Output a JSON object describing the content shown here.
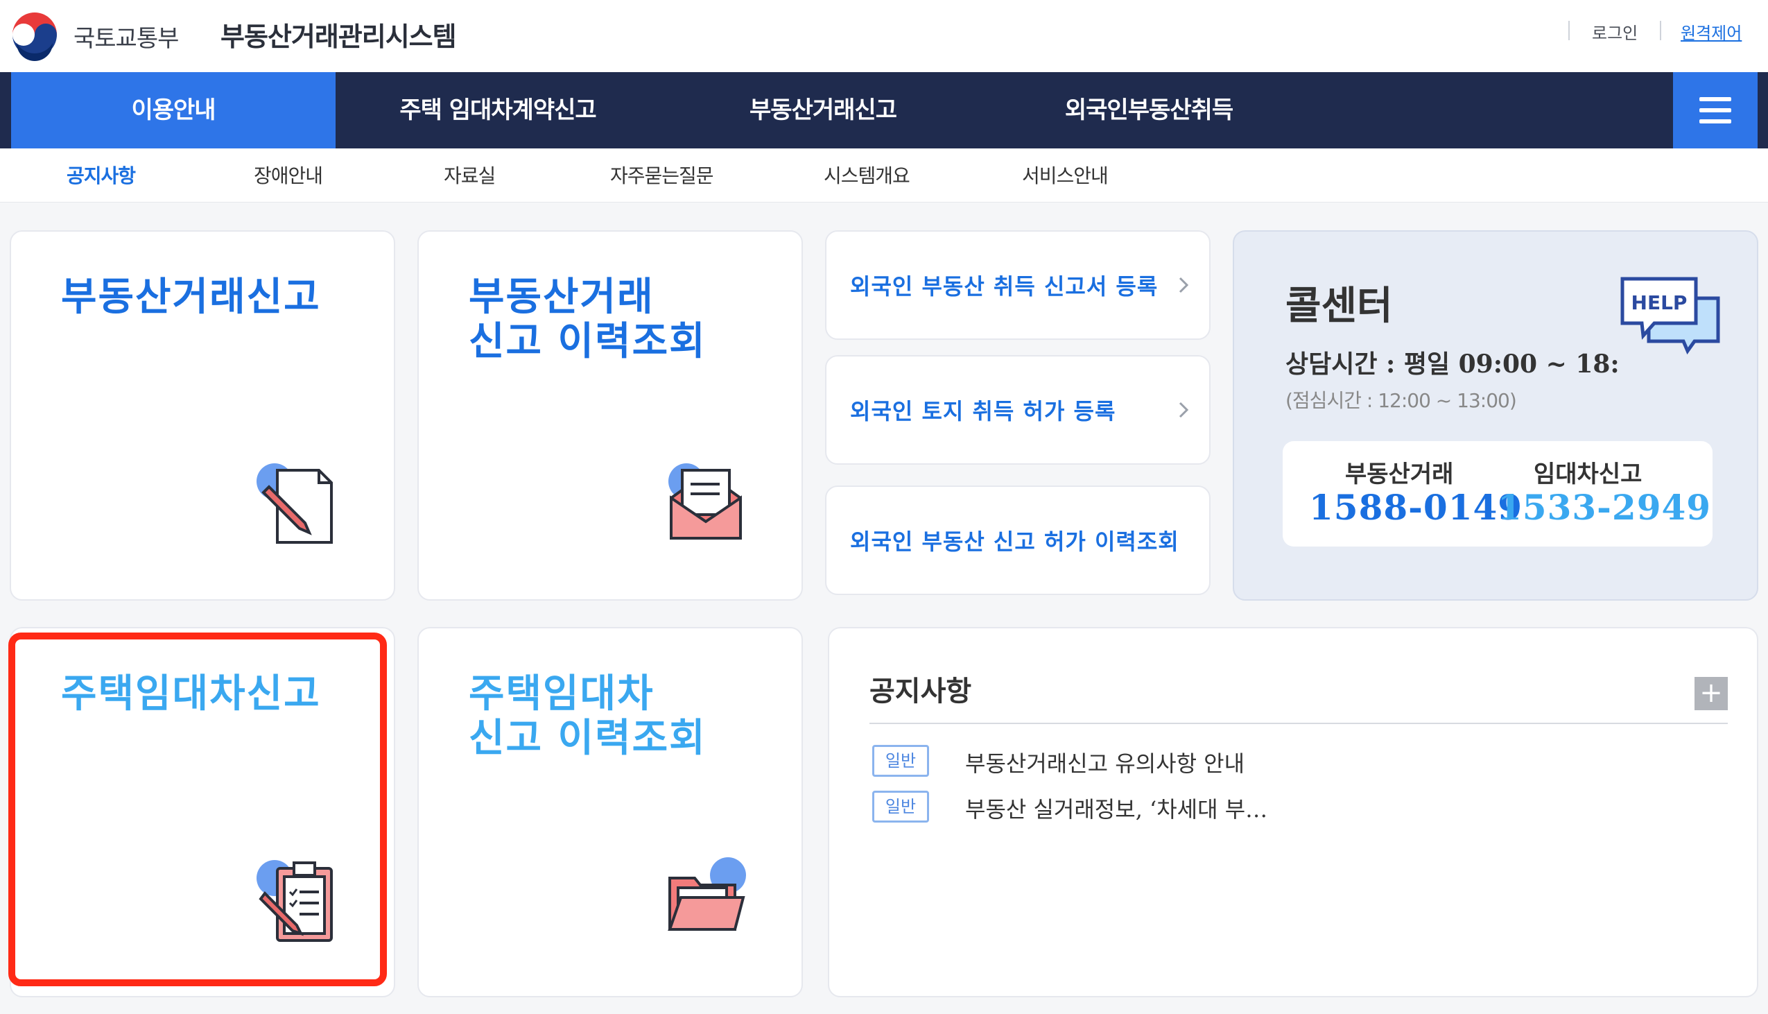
{
  "header": {
    "ministry": "국토교통부",
    "system_title": "부동산거래관리시스템",
    "login": "로그인",
    "remote": "원격제어"
  },
  "gnb": {
    "items": [
      "이용안내",
      "주택 임대차계약신고",
      "부동산거래신고",
      "외국인부동산취득"
    ],
    "active_index": 0,
    "menu_icon": "hamburger-icon"
  },
  "subnav": {
    "items": [
      "공지사항",
      "장애안내",
      "자료실",
      "자주묻는질문",
      "시스템개요",
      "서비스안내"
    ],
    "active_index": 0
  },
  "cards": {
    "trade_report": {
      "title": "부동산거래신고",
      "icon": "document-pen-icon"
    },
    "trade_history": {
      "title_line1": "부동산거래",
      "title_line2": "신고 이력조회",
      "icon": "envelope-letter-icon"
    },
    "lease_report": {
      "title": "주택임대차신고",
      "icon": "clipboard-checklist-icon"
    },
    "lease_history": {
      "title_line1": "주택임대차",
      "title_line2": "신고 이력조회",
      "icon": "open-folder-icon"
    }
  },
  "foreign_links": [
    {
      "label": "외국인 부동산 취득 신고서 등록"
    },
    {
      "label": "외국인 토지 취득 허가 등록"
    },
    {
      "label": "외국인 부동산 신고 허가 이력조회"
    }
  ],
  "call_center": {
    "title": "콜센터",
    "hours": "상담시간 : 평일 09:00 ~ 18:",
    "lunch": "(점심시간 : 12:00 ~ 13:00)",
    "help_badge": "HELP",
    "lines": [
      {
        "label": "부동산거래",
        "number": "1588-0149",
        "color": "#1a6fe0"
      },
      {
        "label": "임대차신고",
        "number": "1533-2949",
        "color": "#3aa8f0"
      }
    ]
  },
  "notice": {
    "title": "공지사항",
    "more": "+",
    "items": [
      {
        "badge": "일반",
        "text": "부동산거래신고 유의사항 안내"
      },
      {
        "badge": "일반",
        "text": "부동산 실거래정보, ‘차세대 부…"
      }
    ]
  },
  "colors": {
    "navy": "#1f2b4e",
    "primary_blue": "#2e75e8",
    "link_blue": "#1a6fe0",
    "light_blue": "#3aa8f0",
    "highlight_red": "#ff2a16"
  }
}
